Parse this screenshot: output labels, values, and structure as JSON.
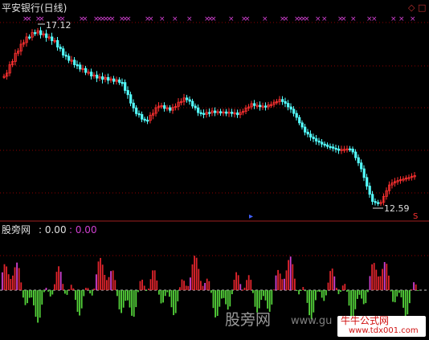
{
  "header": {
    "title": "平安银行(日线)",
    "icons": [
      "diamond-icon",
      "square-icon"
    ]
  },
  "price_panel": {
    "high_label": "17.12",
    "low_label": "12.59",
    "marker_glyph": "×",
    "colors": {
      "up": "#ff3030",
      "down": "#54ffff",
      "marker": "#d040d0",
      "grid": "#8b0000"
    }
  },
  "indicator_panel": {
    "name": "股旁网",
    "value1": ": 0.00",
    "value2": ": 0.00",
    "colors": {
      "positive": "#e0242c",
      "negative": "#54d23a",
      "highlight": "#d040d0",
      "zero_line": "#c8c8c8"
    }
  },
  "watermark": {
    "site_name": "股旁网",
    "site_url": "www.gu",
    "stamp_title": "牛牛公式网",
    "stamp_url": "www.tdx001.com"
  }
}
